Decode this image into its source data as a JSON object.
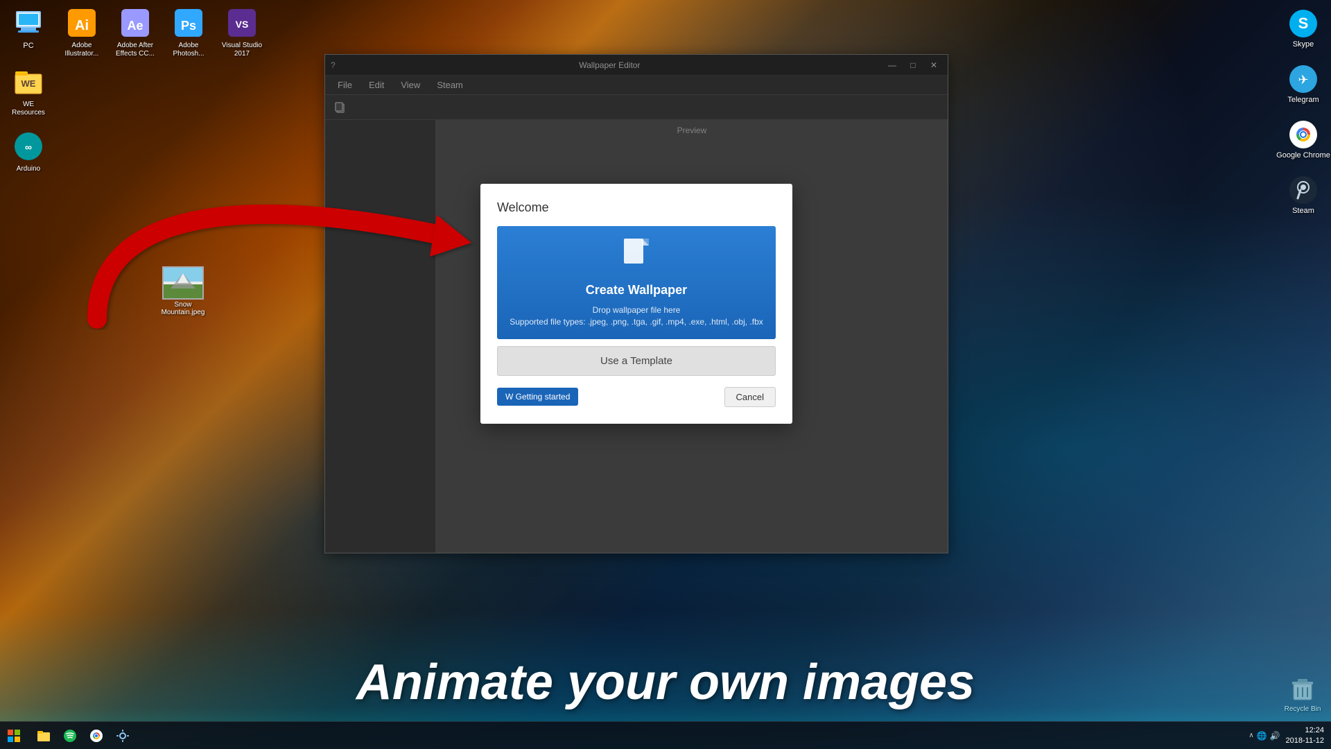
{
  "desktop": {
    "background_colors": [
      "#1a0a00",
      "#8b3a00",
      "#0d1a2e",
      "#3a5a7a"
    ]
  },
  "bottom_text": {
    "headline": "Animate your own images"
  },
  "desktop_icons_left": [
    {
      "id": "pc",
      "label": "PC",
      "icon": "🖥️"
    },
    {
      "id": "we-resources",
      "label": "WE Resources",
      "icon": "📁"
    },
    {
      "id": "arduino",
      "label": "Arduino",
      "icon": "🔵"
    }
  ],
  "desktop_icons_top_left": [
    {
      "id": "adobe-illustrator",
      "label": "Adobe Illustrator...",
      "icon": "Ai",
      "color": "#FF9A00"
    },
    {
      "id": "adobe-after-effects",
      "label": "Adobe After Effects CC...",
      "icon": "Ae",
      "color": "#9999FF"
    },
    {
      "id": "adobe-photoshop",
      "label": "Adobe Photosh...",
      "icon": "Ps",
      "color": "#31A8FF"
    },
    {
      "id": "visual-studio",
      "label": "Visual Studio 2017",
      "icon": "VS",
      "color": "#5C2D91"
    }
  ],
  "desktop_icons_top_right": [
    {
      "id": "skype",
      "label": "Skype",
      "color": "#00AFF0"
    },
    {
      "id": "telegram",
      "label": "Telegram",
      "color": "#2CA5E0"
    },
    {
      "id": "google-chrome",
      "label": "Google Chrome",
      "color": "#4285F4"
    },
    {
      "id": "steam",
      "label": "Steam",
      "color": "#1b2838"
    }
  ],
  "snow_mountain": {
    "label": "Snow Mountain.jpeg"
  },
  "wallpaper_editor": {
    "title": "Wallpaper Editor",
    "menu": [
      "File",
      "Edit",
      "View",
      "Steam"
    ],
    "toolbar": {
      "copy_icon": "⧉"
    },
    "preview_label": "Preview"
  },
  "dialog": {
    "title": "Welcome",
    "create_wallpaper": {
      "icon": "📄",
      "title": "Create Wallpaper",
      "drop_text": "Drop wallpaper file here",
      "supported_text": "Supported file types: .jpeg, .png, .tga, .gif, .mp4, .exe, .html, .obj, .fbx"
    },
    "use_template_label": "Use a Template",
    "getting_started_label": "W  Getting started",
    "cancel_label": "Cancel"
  },
  "taskbar": {
    "start_label": "⊞",
    "time": "12:24",
    "date": "2018-11-12",
    "tray_icons": [
      "^",
      "🔊",
      "🌐"
    ]
  }
}
